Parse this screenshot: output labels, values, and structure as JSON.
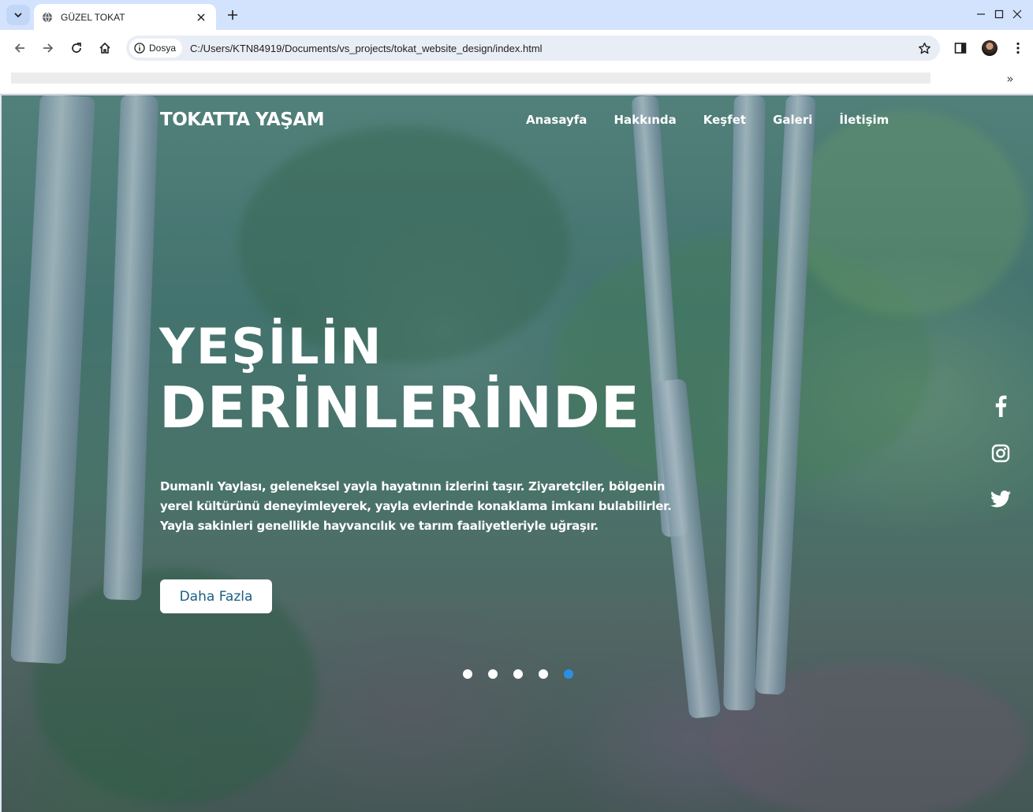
{
  "browser": {
    "tab_title": "GÜZEL TOKAT",
    "site_chip_label": "Dosya",
    "url": "C:/Users/KTN84919/Documents/vs_projects/tokat_website_design/index.html",
    "bookmarks_overflow": "»"
  },
  "page": {
    "logo": "TOKATTA YAŞAM",
    "nav": [
      "Anasayfa",
      "Hakkında",
      "Keşfet",
      "Galeri",
      "İletişim"
    ],
    "hero_line1": "YEŞİLİN",
    "hero_line2": "DERİNLERİNDE",
    "hero_description": "Dumanlı Yaylası, geleneksel yayla hayatının izlerini taşır. Ziyaretçiler, bölgenin yerel kültürünü deneyimleyerek, yayla evlerinde konaklama imkanı bulabilirler. Yayla sakinleri genellikle hayvancılık ve tarım faaliyetleriyle uğraşır.",
    "cta_label": "Daha Fazla",
    "slider": {
      "total": 5,
      "active_index": 5
    },
    "social": [
      "facebook-icon",
      "instagram-icon",
      "twitter-icon"
    ]
  },
  "colors": {
    "tabstrip": "#d3e3fd",
    "cta_text": "#1a5f86",
    "active_dot": "#2a8fe0"
  }
}
